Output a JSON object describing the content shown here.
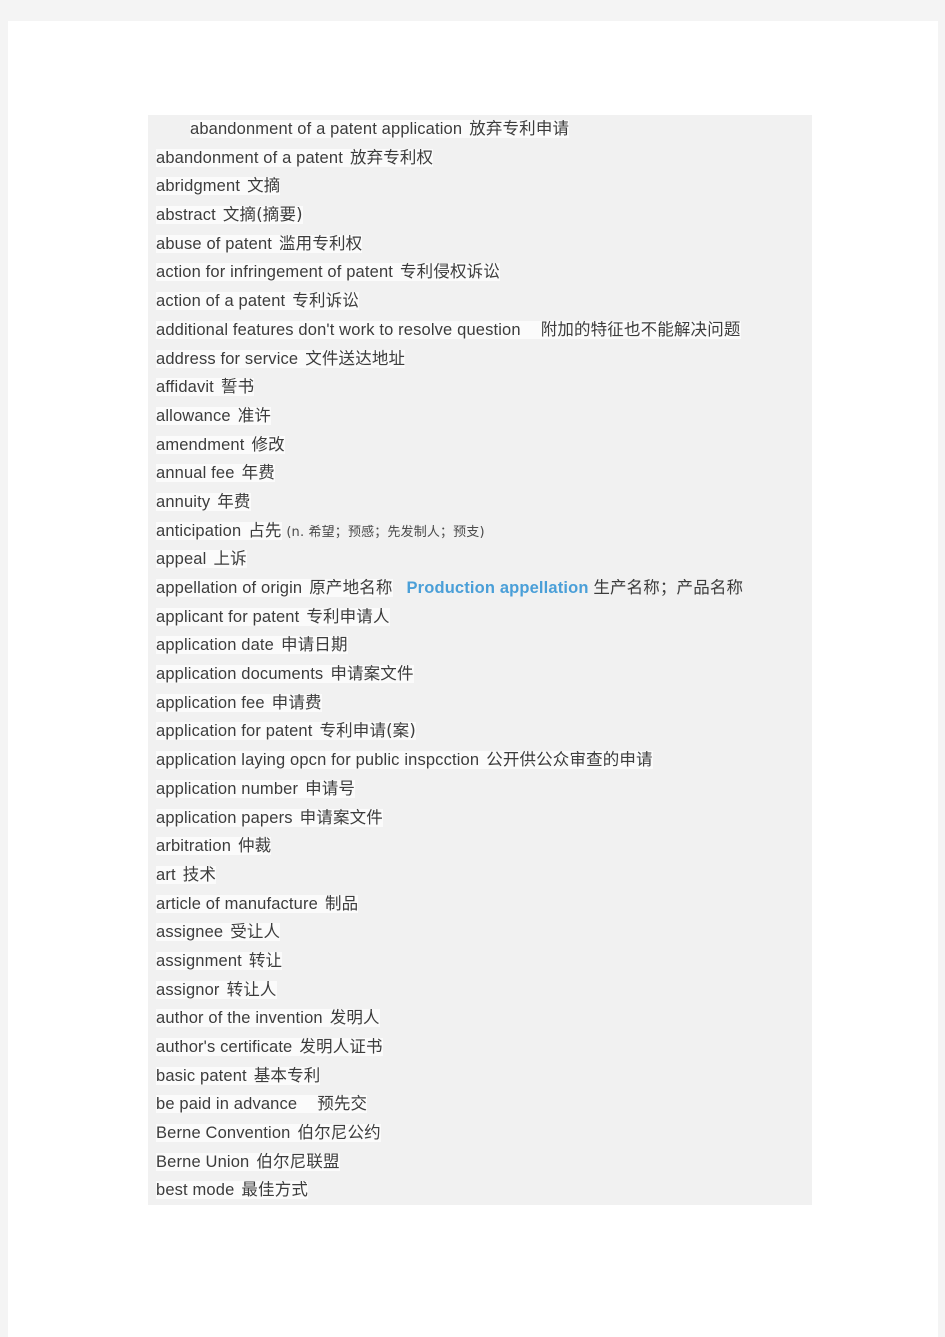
{
  "document": {
    "type": "bilingual-glossary",
    "subject": "patent terminology English-Chinese glossary",
    "colors": {
      "page_background": "#ffffff",
      "outer_background": "#f4f4f4",
      "block_background": "#f1f1f1",
      "text_highlight": "#fbfbfb",
      "text": "#3c3c3c",
      "accent_blue": "#4a9fd8"
    }
  },
  "entries": [
    {
      "term": "abandonment of a patent application",
      "cn": "放弃专利申请",
      "indent": true
    },
    {
      "term": "abandonment of a patent",
      "cn": "放弃专利权"
    },
    {
      "term": "abridgment",
      "cn": "文摘"
    },
    {
      "term": "abstract",
      "cn": "文摘(摘要)"
    },
    {
      "term": "abuse of patent",
      "cn": "滥用专利权"
    },
    {
      "term": "action for infringement of patent",
      "cn": "专利侵权诉讼"
    },
    {
      "term": "action of a patent",
      "cn": "专利诉讼"
    },
    {
      "term": "additional features don't work to resolve question",
      "cn": "附加的特征也不能解决问题",
      "wide_gap": true
    },
    {
      "term": "address for service",
      "cn": "文件送达地址"
    },
    {
      "term": "affidavit",
      "cn": "誓书"
    },
    {
      "term": "allowance",
      "cn": "准许"
    },
    {
      "term": "amendment",
      "cn": "修改"
    },
    {
      "term": "annual fee",
      "cn": "年费"
    },
    {
      "term": "annuity",
      "cn": "年费"
    },
    {
      "term": "anticipation",
      "cn": "占先",
      "note": "(n. 希望；预感；先发制人；预支)"
    },
    {
      "term": "appeal",
      "cn": "上诉"
    },
    {
      "term": "appellation of origin",
      "cn": "原产地名称",
      "accent_term": "Production appellation",
      "accent_cn": "生产名称；产品名称"
    },
    {
      "term": "applicant for patent",
      "cn": "专利申请人"
    },
    {
      "term": "application date",
      "cn": "申请日期"
    },
    {
      "term": "application documents",
      "cn": "申请案文件"
    },
    {
      "term": "application fee",
      "cn": "申请费"
    },
    {
      "term": "application for patent",
      "cn": "专利申请(案)"
    },
    {
      "term": "application laying opcn for public inspcction",
      "cn": "公开供公众审查的申请"
    },
    {
      "term": "application number",
      "cn": "申请号"
    },
    {
      "term": "application papers",
      "cn": "申请案文件"
    },
    {
      "term": "arbitration",
      "cn": "仲裁"
    },
    {
      "term": "art",
      "cn": "技术"
    },
    {
      "term": "article of manufacture",
      "cn": "制品"
    },
    {
      "term": "assignee",
      "cn": "受让人"
    },
    {
      "term": "assignment",
      "cn": "转让"
    },
    {
      "term": "assignor",
      "cn": "转让人"
    },
    {
      "term": "author of the invention",
      "cn": "发明人"
    },
    {
      "term": "author's certificate",
      "cn": "发明人证书"
    },
    {
      "term": "basic patent",
      "cn": "基本专利"
    },
    {
      "term": "be paid in advance",
      "cn": "预先交",
      "wide_gap": true
    },
    {
      "term": "Berne Convention",
      "cn": "伯尔尼公约"
    },
    {
      "term": "Berne Union",
      "cn": "伯尔尼联盟"
    },
    {
      "term": "best mode",
      "cn": "最佳方式"
    }
  ]
}
